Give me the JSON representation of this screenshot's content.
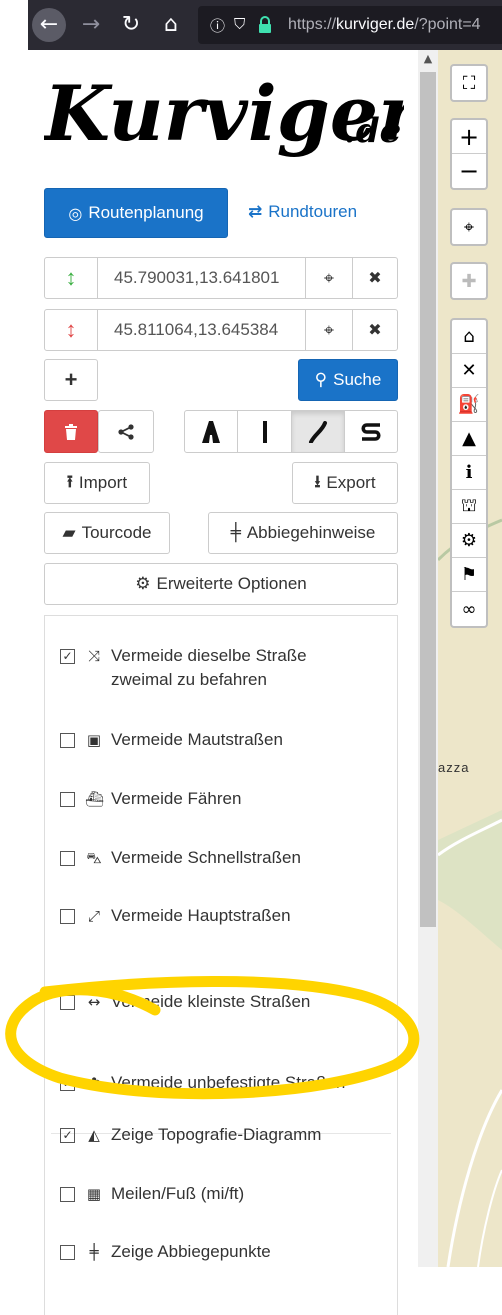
{
  "browser": {
    "url_prefix": "https://",
    "url_domain": "kurviger.de",
    "url_path": "/?point=4"
  },
  "logo": {
    "text": "Kurviger",
    "suffix": ".de"
  },
  "tabs": {
    "route_planning": "Routenplanung",
    "round_tours": "Rundtouren"
  },
  "waypoints": [
    {
      "value": "45.790031,13.641801",
      "color": "#3cb043"
    },
    {
      "value": "45.811064,13.645384",
      "color": "#e04848"
    }
  ],
  "buttons": {
    "search": "Suche",
    "import": "Import",
    "export": "Export",
    "tourcode": "Tourcode",
    "turn_instructions": "Abbiegehinweise",
    "advanced_options": "Erweiterte Optionen"
  },
  "route_types": [
    "fastest",
    "straight",
    "curvy",
    "extra-curvy"
  ],
  "options": [
    {
      "label": "Vermeide dieselbe Straße zweimal zu befahren",
      "checked": true,
      "icon": "shuffle-icon"
    },
    {
      "label": "Vermeide Mautstraßen",
      "checked": false,
      "icon": "money-icon"
    },
    {
      "label": "Vermeide Fähren",
      "checked": false,
      "icon": "ship-icon"
    },
    {
      "label": "Vermeide Schnellstraßen",
      "checked": false,
      "icon": "car-icon"
    },
    {
      "label": "Vermeide Hauptstraßen",
      "checked": false,
      "icon": "expand-arrows-icon"
    },
    {
      "label": "Vermeide kleinste Straßen",
      "checked": false,
      "icon": "left-right-arrow-icon"
    },
    {
      "label": "Vermeide unbefestigte Straßen",
      "checked": true,
      "icon": "paw-icon"
    },
    {
      "label": "Zeige Topografie-Diagramm",
      "checked": true,
      "icon": "area-chart-icon"
    },
    {
      "label": "Meilen/Fuß (mi/ft)",
      "checked": false,
      "icon": "calculator-icon"
    },
    {
      "label": "Zeige Abbiegepunkte",
      "checked": false,
      "icon": "signpost-icon"
    }
  ],
  "map": {
    "label": "azza"
  },
  "annotation": {
    "color": "#ffd400"
  }
}
